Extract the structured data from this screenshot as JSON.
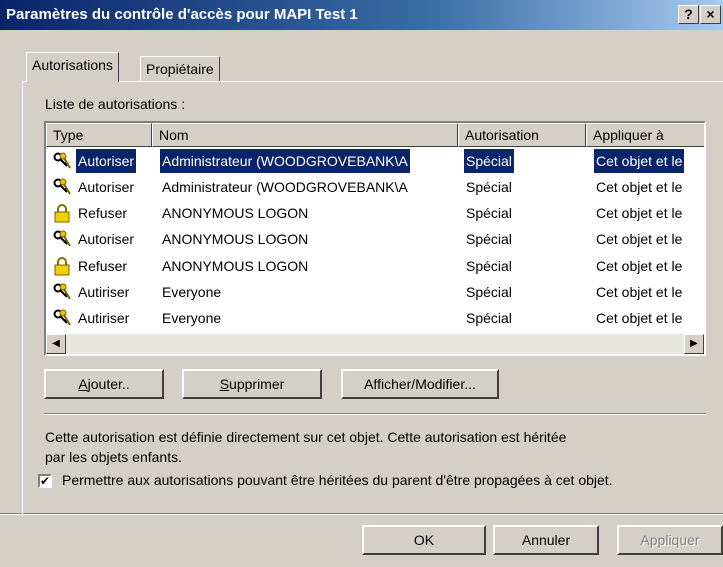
{
  "window": {
    "title": "Paramètres du contrôle d'accès pour MAPI Test 1",
    "help_btn": "?",
    "close_btn": "×"
  },
  "tabs": [
    {
      "label": "Autorisations",
      "selected": true
    },
    {
      "label": "Propiétaire",
      "selected": false
    }
  ],
  "list_label": "Liste de autorisations :",
  "columns": [
    "Type",
    "Nom",
    "Autorisation",
    "Appliquer à"
  ],
  "rows": [
    {
      "type": "Autoriser",
      "icon": "users-keys-icon",
      "nom": "Administrateur (WOODGROVEBANK\\A",
      "aut": "Spécial",
      "app": "Cet objet et le",
      "selected": true
    },
    {
      "type": "Autoriser",
      "icon": "users-keys-icon",
      "nom": "Administrateur (WOODGROVEBANK\\A",
      "aut": "Spécial",
      "app": "Cet objet et le",
      "selected": false
    },
    {
      "type": "Refuser",
      "icon": "lock-icon",
      "nom": "ANONYMOUS LOGON",
      "aut": "Spécial",
      "app": "Cet objet et le",
      "selected": false
    },
    {
      "type": "Autoriser",
      "icon": "users-keys-icon",
      "nom": "ANONYMOUS LOGON",
      "aut": "Spécial",
      "app": "Cet objet et le",
      "selected": false
    },
    {
      "type": "Refuser",
      "icon": "lock-icon",
      "nom": "ANONYMOUS LOGON",
      "aut": "Spécial",
      "app": "Cet objet et le",
      "selected": false
    },
    {
      "type": "Autiriser",
      "icon": "users-keys-icon",
      "nom": "Everyone",
      "aut": "Spécial",
      "app": "Cet objet et le",
      "selected": false
    },
    {
      "type": "Autiriser",
      "icon": "users-keys-icon",
      "nom": "Everyone",
      "aut": "Spécial",
      "app": "Cet objet et le",
      "selected": false
    }
  ],
  "buttons": {
    "add_accel": "A",
    "add_rest": "jouter..",
    "delete_accel": "S",
    "delete_rest": "upprimer",
    "edit": "Afficher/Modifier..."
  },
  "description": "Cette autorisation est définie directement sur cet objet.  Cette autorisation est héritée",
  "description2": "par les objets enfants.",
  "inherit_checkbox": {
    "checked": true,
    "mark": "✔",
    "label": "Permettre aux autorisations pouvant être héritées du parent d'être propagées à cet objet."
  },
  "footer": {
    "ok": "OK",
    "cancel": "Annuler",
    "apply": "Appliquer"
  },
  "scroll": {
    "left": "◀",
    "right": "▶"
  },
  "colors": {
    "title_active": "#0a246a",
    "selection": "#0a246a",
    "face": "#d4d0c8"
  }
}
